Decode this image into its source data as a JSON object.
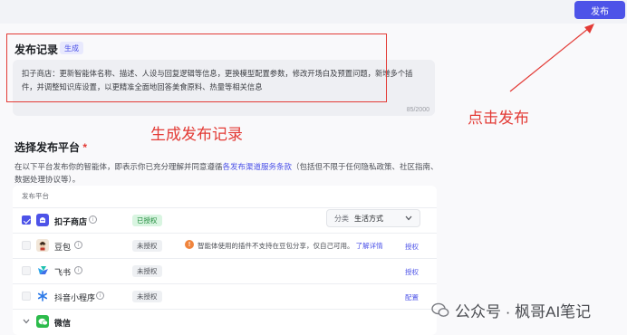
{
  "header": {
    "publish_label": "发布"
  },
  "record": {
    "title": "发布记录",
    "tag": "生成",
    "text": "扣子商店：更新智能体名称、描述、人设与回复逻辑等信息，更换模型配置参数，修改开场白及预置问题，新增多个插件，并调整知识库设置，以更精准全面地回答美食原料、热量等相关信息",
    "counter": "85/2000"
  },
  "annotations": {
    "generate_record": "生成发布记录",
    "click_publish": "点击发布"
  },
  "platforms": {
    "title": "选择发布平台",
    "required_mark": "*",
    "desc_before": "在以下平台发布你的智能体，即表示你已充分理解并同意遵循",
    "desc_link": "各发布渠道服务条款",
    "desc_after": "（包括但不限于任何隐私政策、社区指南、数据处理协议等）。",
    "table_header": "发布平台",
    "rows": [
      {
        "name": "扣子商店",
        "status": "已授权",
        "checked": true,
        "category_label": "分类",
        "category_value": "生活方式"
      },
      {
        "name": "豆包",
        "status": "未授权",
        "checked": false,
        "warning": "智能体使用的插件不支持在豆包分享，仅自己可用。",
        "detail_link": "了解详情",
        "action": "授权"
      },
      {
        "name": "飞书",
        "status": "未授权",
        "checked": false,
        "action": "授权"
      },
      {
        "name": "抖音小程序",
        "status": "未授权",
        "checked": false,
        "action": "配置"
      },
      {
        "name": "微信"
      }
    ]
  },
  "watermark": {
    "text": "公众号 · 枫哥AI笔记"
  },
  "colors": {
    "accent": "#4d53e8",
    "annotation_red": "#e33b36",
    "authorized_green": "#1f8a3b"
  }
}
